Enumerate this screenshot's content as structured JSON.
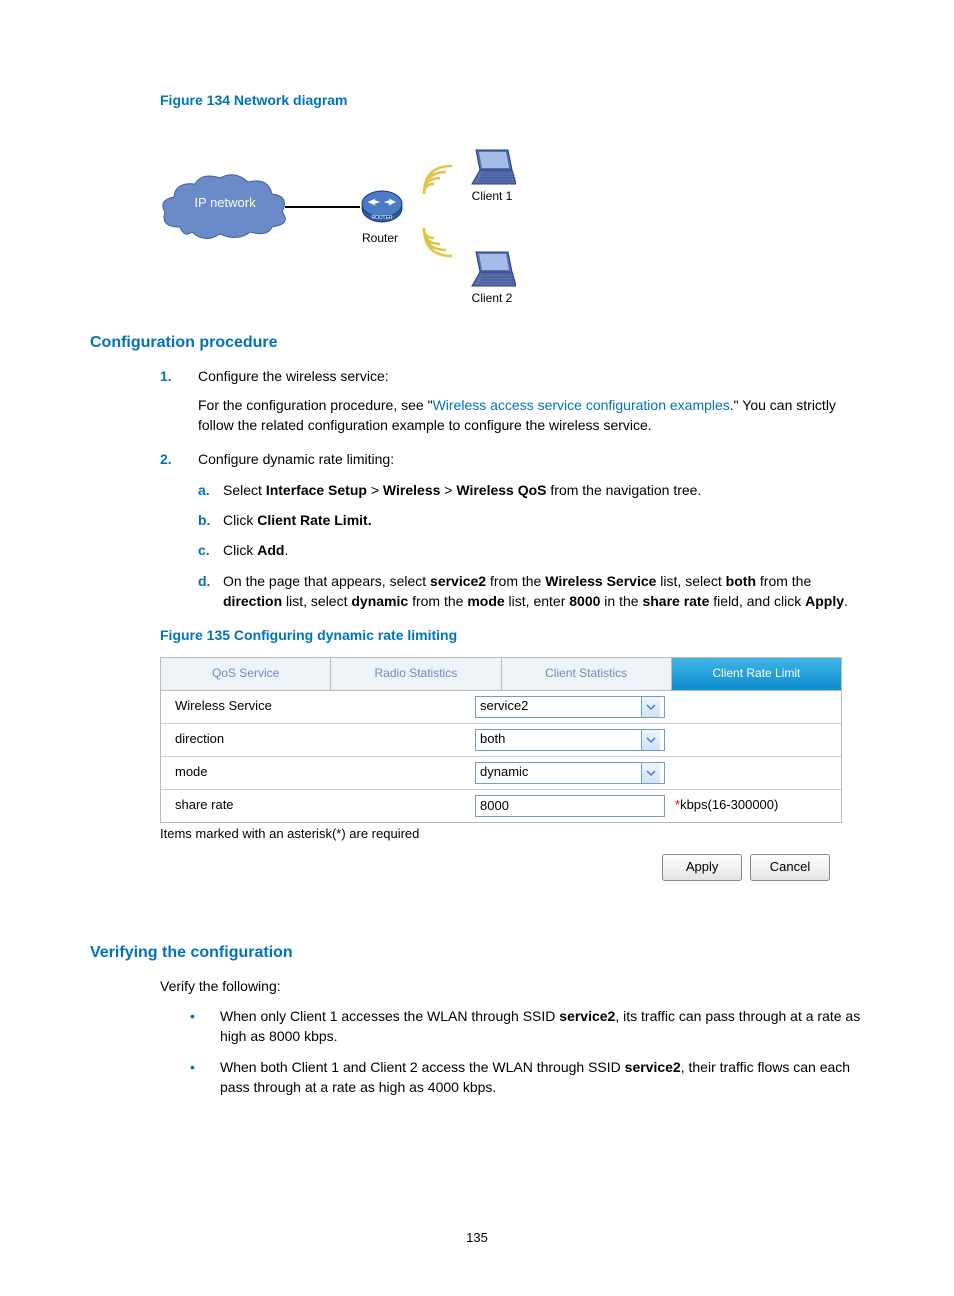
{
  "figure134": {
    "caption": "Figure 134 Network diagram",
    "cloud_label": "IP network",
    "router_label": "Router",
    "client1_label": "Client 1",
    "client2_label": "Client 2"
  },
  "sections": {
    "config_h": "Configuration procedure",
    "verify_h": "Verifying the configuration"
  },
  "steps": {
    "s1_num": "1.",
    "s1_text": "Configure the wireless service:",
    "s1_p1_a": "For the configuration procedure, see \"",
    "s1_link": "Wireless access service configuration examples",
    "s1_p1_b": ".\" You can strictly follow the related configuration example to configure the wireless service.",
    "s2_num": "2.",
    "s2_text": "Configure dynamic rate limiting:",
    "a_let": "a.",
    "a_pre": "Select ",
    "a_b1": "Interface Setup",
    "a_gt1": " > ",
    "a_b2": "Wireless",
    "a_gt2": " > ",
    "a_b3": "Wireless QoS",
    "a_post": " from the navigation tree.",
    "b_let": "b.",
    "b_pre": "Click ",
    "b_b1": "Client Rate Limit.",
    "c_let": "c.",
    "c_pre": "Click ",
    "c_b1": "Add",
    "c_post": ".",
    "d_let": "d.",
    "d_t1": "On the page that appears, select ",
    "d_b1": "service2",
    "d_t2": " from the ",
    "d_b2": "Wireless Service",
    "d_t3": " list, select ",
    "d_b3": "both",
    "d_t4": " from the ",
    "d_b4": "direction",
    "d_t5": " list, select ",
    "d_b5": "dynamic",
    "d_t6": " from the ",
    "d_b6": "mode",
    "d_t7": " list, enter ",
    "d_b7": "8000",
    "d_t8": " in the ",
    "d_b8": "share rate",
    "d_t9": " field, and click ",
    "d_b9": "Apply",
    "d_t10": "."
  },
  "figure135": {
    "caption": "Figure 135 Configuring dynamic rate limiting",
    "tabs": [
      "QoS Service",
      "Radio Statistics",
      "Client Statistics",
      "Client Rate Limit"
    ],
    "rows": {
      "r1_label": "Wireless Service",
      "r1_value": "service2",
      "r2_label": "direction",
      "r2_value": "both",
      "r3_label": "mode",
      "r3_value": "dynamic",
      "r4_label": "share rate",
      "r4_value": "8000",
      "r4_note_star": "*",
      "r4_note": "kbps(16-300000)"
    },
    "required_note": "Items marked with an asterisk(*) are required",
    "apply": "Apply",
    "cancel": "Cancel"
  },
  "verify": {
    "intro": "Verify the following:",
    "b1_a": "When only Client 1 accesses the WLAN through SSID ",
    "b1_bold": "service2",
    "b1_b": ", its traffic can pass through at a rate as high as 8000 kbps.",
    "b2_a": "When both Client 1 and Client 2 access the WLAN through SSID ",
    "b2_bold": "service2",
    "b2_b": ", their traffic flows can each pass through at a rate as high as 4000 kbps."
  },
  "page_number": "135"
}
